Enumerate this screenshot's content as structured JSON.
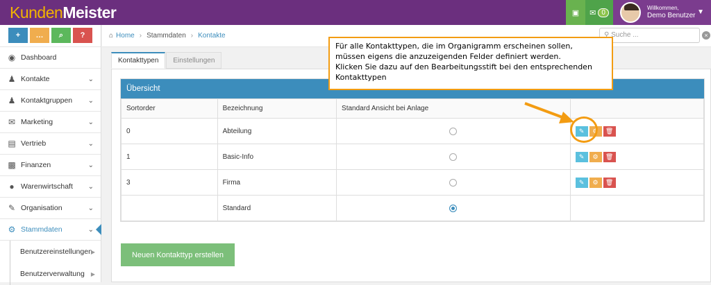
{
  "app": {
    "logo_part1": "Kunden",
    "logo_part2": "Meister"
  },
  "topbar": {
    "messages_count": "0",
    "welcome": "Willkommen,",
    "user": "Demo Benutzer"
  },
  "quick_buttons": [
    "+",
    "…",
    "⌕",
    "?"
  ],
  "sidebar": {
    "items": [
      {
        "label": "Dashboard",
        "icon": "dashboard-icon"
      },
      {
        "label": "Kontakte",
        "icon": "user-icon"
      },
      {
        "label": "Kontaktgruppen",
        "icon": "users-icon"
      },
      {
        "label": "Marketing",
        "icon": "envelope-icon"
      },
      {
        "label": "Vertrieb",
        "icon": "bar-chart-icon"
      },
      {
        "label": "Finanzen",
        "icon": "money-icon"
      },
      {
        "label": "Warenwirtschaft",
        "icon": "globe-icon"
      },
      {
        "label": "Organisation",
        "icon": "edit-icon"
      },
      {
        "label": "Stammdaten",
        "icon": "cogs-icon"
      }
    ],
    "subitems": [
      {
        "label": "Benutzereinstellungen"
      },
      {
        "label": "Benutzerverwaltung"
      }
    ]
  },
  "breadcrumb": {
    "home": "Home",
    "level1": "Stammdaten",
    "level2": "Kontakte"
  },
  "search": {
    "placeholder": "Suche ..."
  },
  "tabs": [
    "Kontakttypen",
    "Einstellungen"
  ],
  "overview": {
    "title": "Übersicht",
    "columns": [
      "Sortorder",
      "Bezeichnung",
      "Standard Ansicht bei Anlage",
      ""
    ],
    "rows": [
      {
        "sortorder": "0",
        "name": "Abteilung",
        "selected": false,
        "actions": true
      },
      {
        "sortorder": "1",
        "name": "Basic-Info",
        "selected": false,
        "actions": true
      },
      {
        "sortorder": "3",
        "name": "Firma",
        "selected": false,
        "actions": true
      },
      {
        "sortorder": "",
        "name": "Standard",
        "selected": true,
        "actions": false
      }
    ]
  },
  "new_button": "Neuen Kontakttyp erstellen",
  "callout": {
    "line1": "Für alle Kontakttypen, die im Organigramm erscheinen sollen,",
    "line2": "müssen eigens die anzuzeigenden  Felder definiert werden.",
    "line3": "Klicken Sie dazu auf den Bearbeitungsstift bei den entsprechenden",
    "line4": "Kontakttypen"
  },
  "colors": {
    "topbar": "#6b2f7e",
    "accent": "#3c8dbc",
    "callout_border": "#f39c12",
    "create_button": "#7cbf7a"
  }
}
